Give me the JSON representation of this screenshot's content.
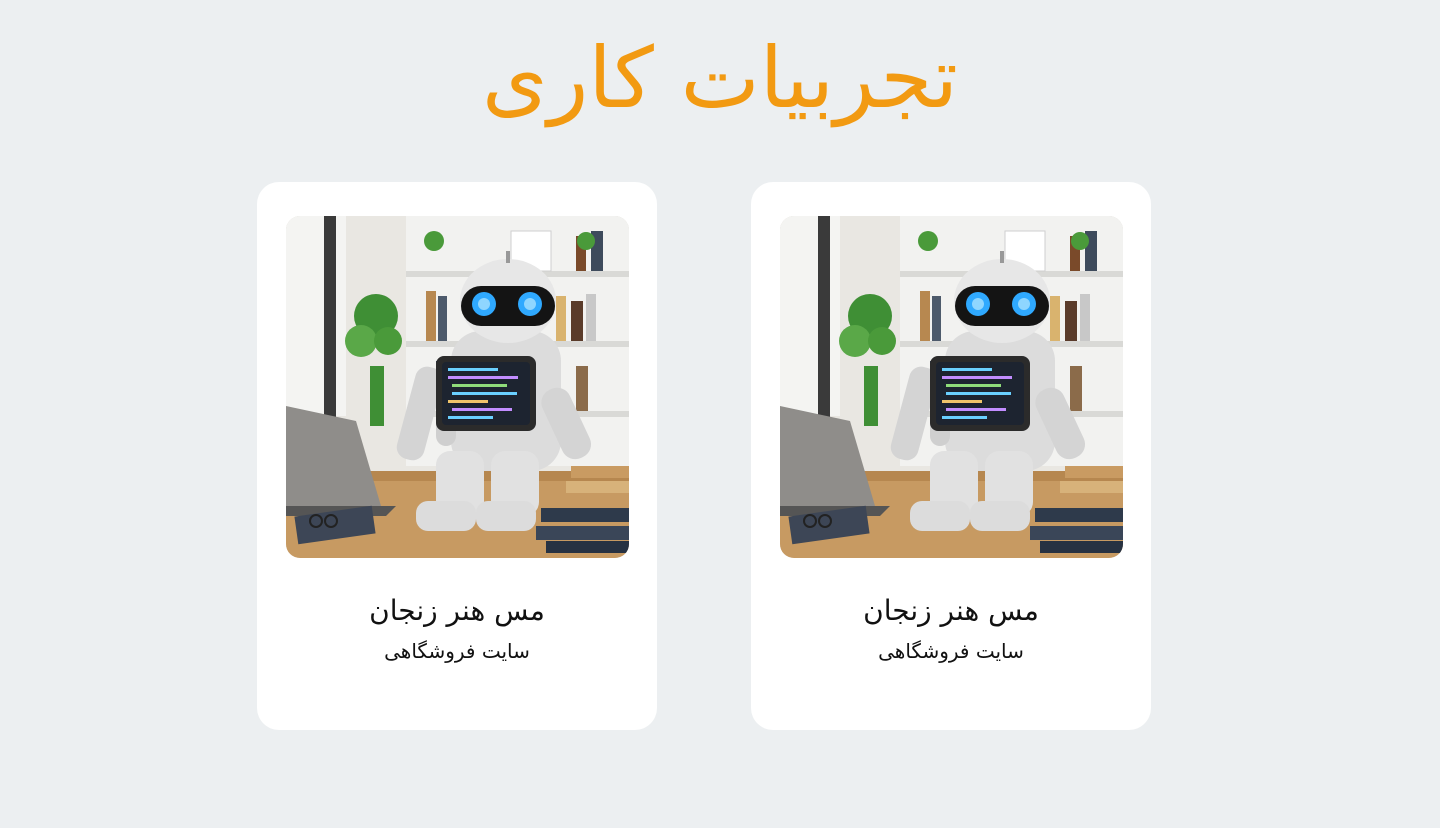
{
  "page": {
    "title": "تجربیات کاری",
    "accent_color": "#f29a12",
    "background_color": "#eceff1"
  },
  "projects": [
    {
      "title": "مس هنر زنجان",
      "subtitle": "سایت فروشگاهی",
      "image_icon": "robot-at-desk-illustration"
    },
    {
      "title": "مس هنر زنجان",
      "subtitle": "سایت فروشگاهی",
      "image_icon": "robot-at-desk-illustration"
    }
  ]
}
